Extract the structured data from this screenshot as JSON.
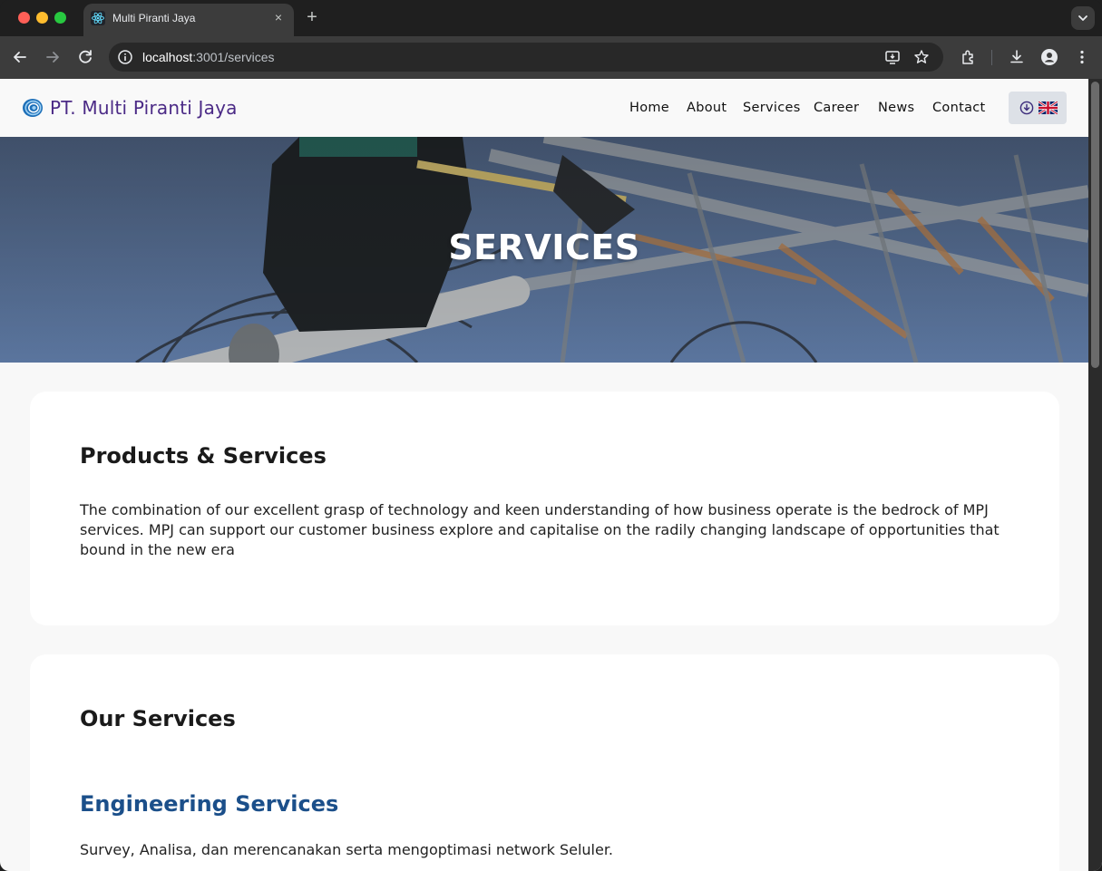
{
  "browser": {
    "tab_title": "Multi Piranti Jaya",
    "url_host": "localhost",
    "url_path": ":3001/services",
    "new_tab_glyph": "+",
    "close_glyph": "×"
  },
  "site": {
    "brand": "PT. Multi Piranti Jaya",
    "nav": [
      "Home",
      "About",
      "Services",
      "Career",
      "News",
      "Contact"
    ],
    "language_icon": "uk-flag-icon"
  },
  "hero": {
    "title": "SERVICES"
  },
  "products": {
    "title": "Products & Services",
    "text": "The combination of our excellent grasp of technology and keen understanding of how business operate is the bedrock of MPJ services. MPJ can support our customer business explore and capitalise on the radily changing landscape of opportunities that bound in the new era"
  },
  "our_services": {
    "title": "Our Services",
    "items": [
      {
        "title": "Engineering Services",
        "description": "Survey, Analisa, dan merencanakan serta mengoptimasi network Seluler."
      }
    ]
  },
  "colors": {
    "brand_purple": "#4b2a86",
    "service_title_blue": "#1b4f8a",
    "lang_button_bg": "#dde1e7"
  }
}
